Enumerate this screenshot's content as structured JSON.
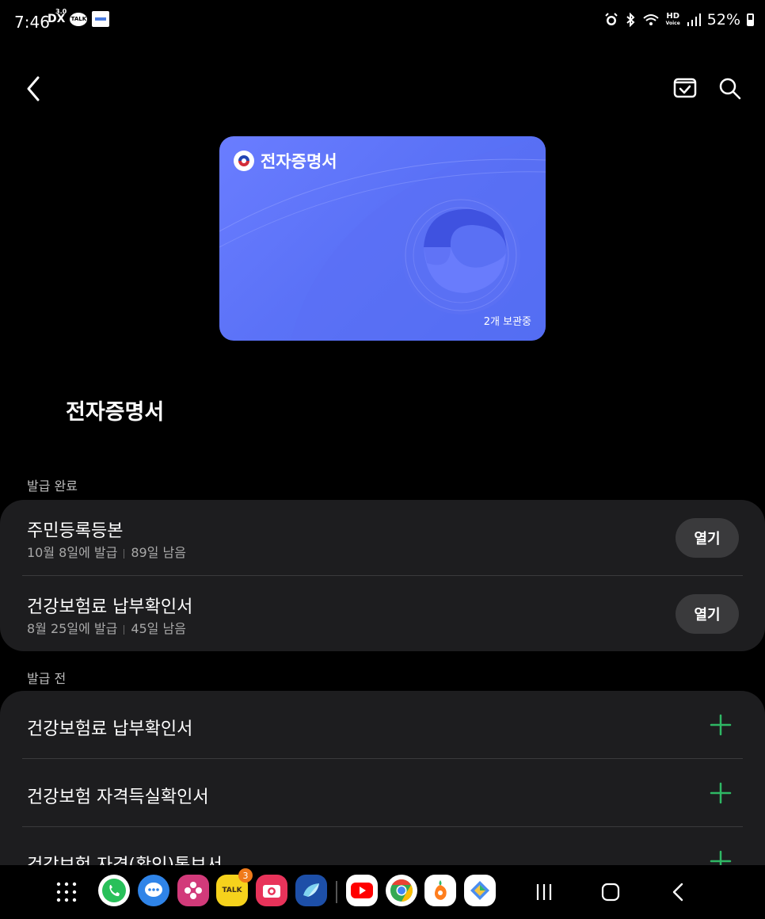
{
  "status_bar": {
    "time": "7:46",
    "dx_label": "DX",
    "dx_super": "3.0",
    "talk_label": "TALK",
    "hd_label": "HD",
    "hd_sub": "Voice",
    "battery": "52%"
  },
  "card": {
    "title": "전자증명서",
    "count": "2개 보관중",
    "color": "#5b72f7"
  },
  "page": {
    "title": "전자증명서"
  },
  "issued_section": {
    "label": "발급 완료",
    "items": [
      {
        "title": "주민등록등본",
        "issued": "10월 8일에 발급",
        "remaining": "89일 남음",
        "action": "열기"
      },
      {
        "title": "건강보험료 납부확인서",
        "issued": "8월 25일에 발급",
        "remaining": "45일 남음",
        "action": "열기"
      }
    ]
  },
  "pending_section": {
    "label": "발급 전",
    "items": [
      {
        "title": "건강보험료 납부확인서"
      },
      {
        "title": "건강보험 자격득실확인서"
      },
      {
        "title": "건강보험 자격(확인)통보서"
      }
    ]
  },
  "dock": {
    "kakao_badge": "3",
    "kakao_label": "TALK"
  },
  "colors": {
    "accent_plus": "#2fb865",
    "row_bg": "#1d1d1f",
    "button_bg": "#3a3a3c"
  }
}
